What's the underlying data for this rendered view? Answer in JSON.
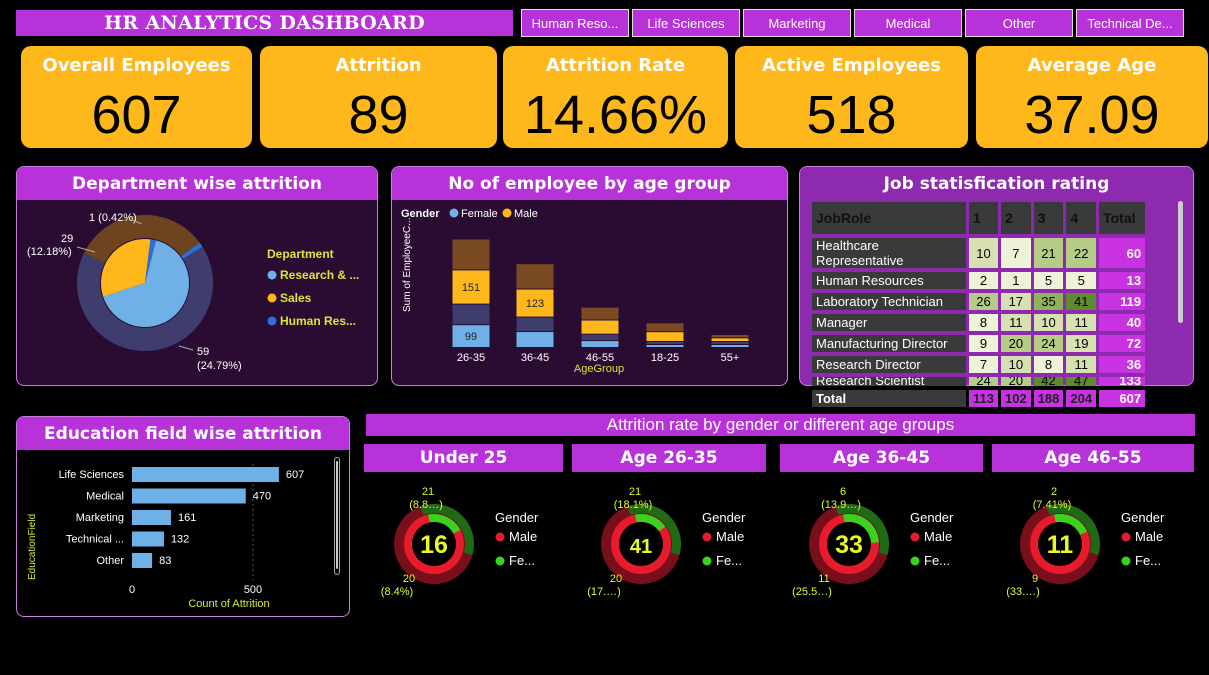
{
  "title": "HR ANALYTICS DASHBOARD",
  "slicers": [
    "Human Reso...",
    "Life Sciences",
    "Marketing",
    "Medical",
    "Other",
    "Technical De..."
  ],
  "kpis": [
    {
      "label": "Overall Employees",
      "value": "607"
    },
    {
      "label": "Attrition",
      "value": "89"
    },
    {
      "label": "Attrition Rate",
      "value": "14.66%"
    },
    {
      "label": "Active Employees",
      "value": "518"
    },
    {
      "label": "Average Age",
      "value": "37.09"
    }
  ],
  "colors": {
    "accent": "#b732d8",
    "kpi": "#ffb81c",
    "panel": "#2a0c33",
    "female": "#6fb1e6",
    "male": "#ffb81c"
  },
  "dept": {
    "title": "Department wise attrition",
    "legend_title": "Department",
    "legend": [
      "Research & ...",
      "Sales",
      "Human Res..."
    ]
  },
  "age": {
    "title": "No of employee by age group",
    "legend_title": "Gender",
    "legend": [
      "Female",
      "Male"
    ]
  },
  "job": {
    "title": "Job statisfication rating",
    "headers": [
      "JobRole",
      "1",
      "2",
      "3",
      "4",
      "Total"
    ],
    "rows": [
      [
        "Healthcare Representative",
        "10",
        "7",
        "21",
        "22",
        "60"
      ],
      [
        "Human Resources",
        "2",
        "1",
        "5",
        "5",
        "13"
      ],
      [
        "Laboratory Technician",
        "26",
        "17",
        "35",
        "41",
        "119"
      ],
      [
        "Manager",
        "8",
        "11",
        "10",
        "11",
        "40"
      ],
      [
        "Manufacturing Director",
        "9",
        "20",
        "24",
        "19",
        "72"
      ],
      [
        "Research Director",
        "7",
        "10",
        "8",
        "11",
        "36"
      ],
      [
        "Research Scientist",
        "24",
        "20",
        "42",
        "47",
        "133"
      ]
    ],
    "total": [
      "Total",
      "113",
      "102",
      "188",
      "204",
      "607"
    ]
  },
  "edu": {
    "title": "Education field wise attrition"
  },
  "gender_section": {
    "title": "Attrition rate by gender or different age groups",
    "groups": [
      {
        "label": "Under 25",
        "center": "16",
        "top_label": "21",
        "top_pct": "(8.8…)",
        "bot_label": "20",
        "bot_pct": "(8.4%)"
      },
      {
        "label": "Age 26-35",
        "center": "41",
        "top_label": "21",
        "top_pct": "(18.1%)",
        "bot_label": "20",
        "bot_pct": "(17.…)"
      },
      {
        "label": "Age 36-45",
        "center": "33",
        "top_label": "6",
        "top_pct": "(13.9…)",
        "bot_label": "11",
        "bot_pct": "(25.5…)"
      },
      {
        "label": "Age 46-55",
        "center": "11",
        "top_label": "2",
        "top_pct": "(7.41%)",
        "bot_label": "9",
        "bot_pct": "(33.…)"
      }
    ],
    "legend_title": "Gender",
    "legend": [
      "Male",
      "Fe..."
    ]
  },
  "chart_data": [
    {
      "type": "pie",
      "title": "Department wise attrition",
      "legend_title": "Department",
      "categories": [
        "Research & Development",
        "Sales",
        "Human Resources"
      ],
      "outer_ring": {
        "values": [
          59,
          29,
          1
        ],
        "labels": [
          "59 (24.79%)",
          "29 (12.18%)",
          "1 (0.42%)"
        ]
      },
      "legend_position": "right"
    },
    {
      "type": "bar",
      "title": "No of employee by age group",
      "xlabel": "AgeGroup",
      "ylabel": "Sum of EmployeeC...",
      "categories": [
        "26-35",
        "36-45",
        "46-55",
        "18-25",
        "55+"
      ],
      "stacked": true,
      "series": [
        {
          "name": "Female",
          "values": [
            99,
            68,
            27,
            9,
            3
          ]
        },
        {
          "name": "Male",
          "values": [
            151,
            123,
            60,
            40,
            12
          ]
        }
      ],
      "labeled": {
        "26-35": {
          "Female": "99",
          "Male": "151"
        },
        "36-45": {
          "Male": "123"
        }
      },
      "legend_position": "top-left"
    },
    {
      "type": "table",
      "title": "Job statisfication rating",
      "columns": [
        "JobRole",
        "1",
        "2",
        "3",
        "4",
        "Total"
      ],
      "rows": [
        [
          "Healthcare Representative",
          10,
          7,
          21,
          22,
          60
        ],
        [
          "Human Resources",
          2,
          1,
          5,
          5,
          13
        ],
        [
          "Laboratory Technician",
          26,
          17,
          35,
          41,
          119
        ],
        [
          "Manager",
          8,
          11,
          10,
          11,
          40
        ],
        [
          "Manufacturing Director",
          9,
          20,
          24,
          19,
          72
        ],
        [
          "Research Director",
          7,
          10,
          8,
          11,
          36
        ],
        [
          "Research Scientist",
          24,
          20,
          42,
          47,
          133
        ]
      ],
      "total": [
        "Total",
        113,
        102,
        188,
        204,
        607
      ]
    },
    {
      "type": "bar",
      "orientation": "horizontal",
      "title": "Education field wise attrition",
      "xlabel": "Count of Attrition",
      "ylabel": "EducationField",
      "categories": [
        "Life Sciences",
        "Medical",
        "Marketing",
        "Technical ...",
        "Other"
      ],
      "values": [
        607,
        470,
        161,
        132,
        83
      ],
      "xlim": [
        0,
        620
      ],
      "xticks": [
        "0",
        "500"
      ]
    },
    {
      "type": "pie",
      "title": "Attrition rate by gender or different age groups",
      "legend_title": "Gender",
      "groups": [
        {
          "label": "Under 25",
          "center": 16,
          "Male": 20,
          "Female": 21
        },
        {
          "label": "Age 26-35",
          "center": 41,
          "Male": 20,
          "Female": 21
        },
        {
          "label": "Age 36-45",
          "center": 33,
          "Male": 11,
          "Female": 6
        },
        {
          "label": "Age 46-55",
          "center": 11,
          "Male": 9,
          "Female": 2
        }
      ]
    }
  ]
}
